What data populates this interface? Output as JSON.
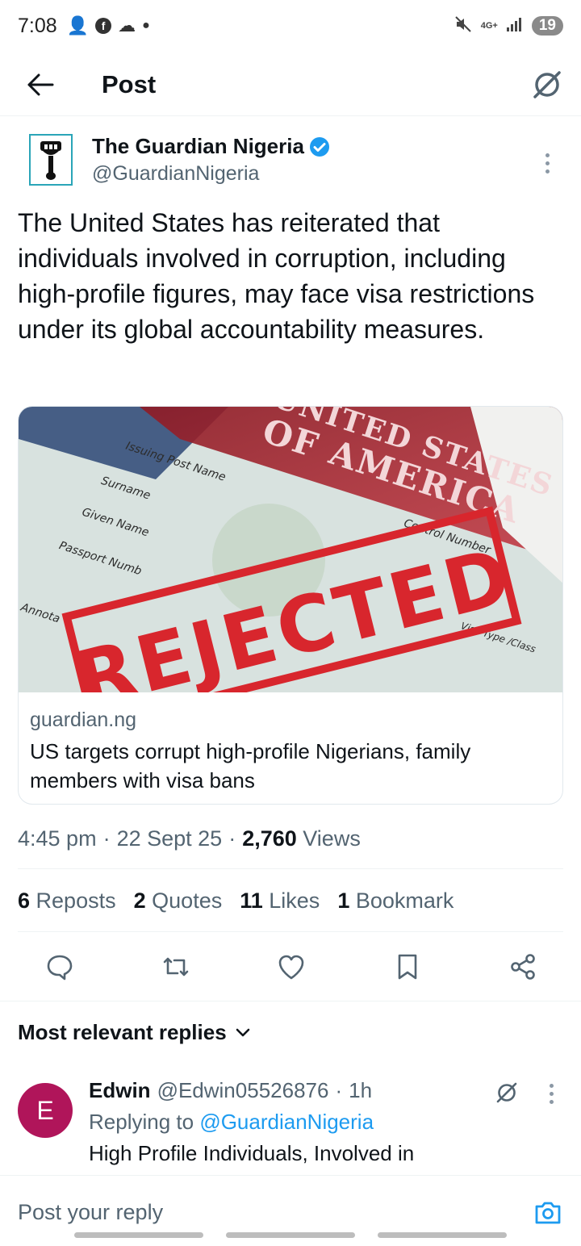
{
  "status_bar": {
    "time": "7:08",
    "network": "4G+",
    "battery": "19"
  },
  "header": {
    "title": "Post"
  },
  "post": {
    "author_name": "The Guardian Nigeria",
    "author_handle": "@GuardianNigeria",
    "text": "The United States has reiterated that individuals involved in corruption, including high-profile figures, may face visa restrictions under its global accountability measures.",
    "card": {
      "image_text": {
        "stamp": "REJECTED",
        "banner_line1": "UNITED STATES",
        "banner_line2": "OF AMERICA",
        "field_1": "Issuing Post Name",
        "field_2": "Surname",
        "field_3": "Given Name",
        "field_4": "Passport Numb",
        "field_5": "Control Number",
        "field_6": "Visa Type /Class",
        "field_7": "Annota"
      },
      "domain": "guardian.ng",
      "title": "US targets corrupt high-profile Nigerians, family members with visa bans"
    },
    "time": "4:45 pm",
    "date": "22 Sept 25",
    "views_count": "2,760",
    "views_label": "Views",
    "stats": {
      "reposts_count": "6",
      "reposts_label": "Reposts",
      "quotes_count": "2",
      "quotes_label": "Quotes",
      "likes_count": "11",
      "likes_label": "Likes",
      "bookmarks_count": "1",
      "bookmarks_label": "Bookmark"
    }
  },
  "replies": {
    "heading": "Most relevant replies",
    "items": [
      {
        "avatar_letter": "E",
        "name": "Edwin",
        "handle": "@Edwin05526876",
        "age": "1h",
        "replying_label": "Replying to",
        "replying_to": "@GuardianNigeria",
        "text": "High Profile Individuals, Involved in"
      }
    ]
  },
  "composer": {
    "placeholder": "Post your reply"
  },
  "colors": {
    "accent": "#1d9bf0",
    "secondary_text": "#536471",
    "avatar_bg": "#b0155a",
    "stamp_red": "#d8262d"
  }
}
